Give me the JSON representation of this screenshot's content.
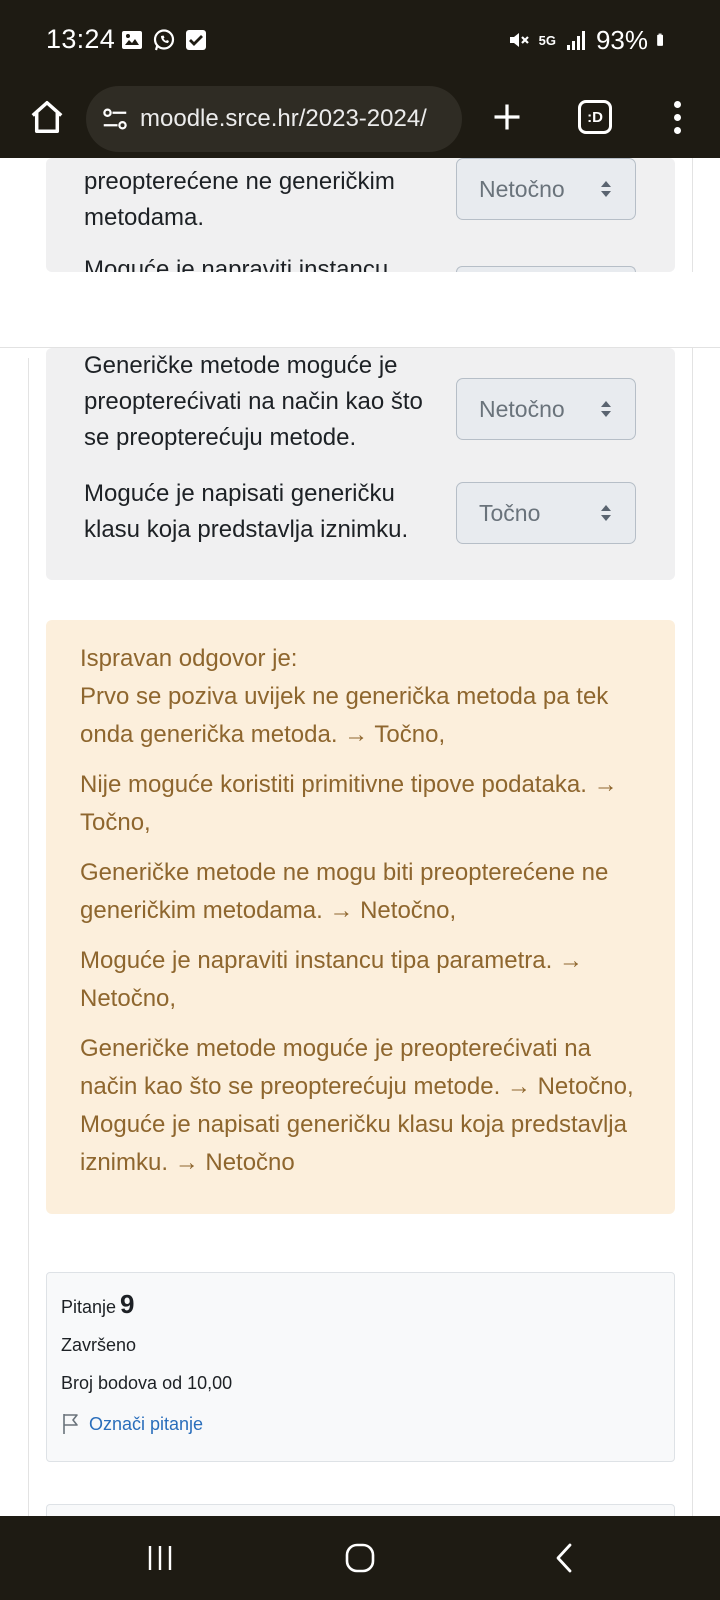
{
  "status_bar": {
    "time": "13:24",
    "network": "5G",
    "battery": "93%"
  },
  "browser": {
    "url": "moodle.srce.hr/2023-2024/",
    "tabs_label": ":D"
  },
  "question_top": {
    "partial_text": "preopterećene ne generičkim metodama.",
    "partial_select": "Netočno",
    "clipped_text": "Moguće je napraviti instancu"
  },
  "question_items": [
    {
      "text": "Generičke metode moguće je preopterećivati na način kao što se preopterećuju metode.",
      "selected": "Netočno"
    },
    {
      "text": "Moguće je napisati generičku klasu koja predstavlja iznimku.",
      "selected": "Točno"
    }
  ],
  "feedback": {
    "heading": "Ispravan odgovor je:",
    "p1": "Prvo se poziva uvijek ne generička metoda pa tek onda generička metoda. → Točno,",
    "p2": "Nije moguće koristiti primitivne tipove podataka. → Točno,",
    "p3": "Generičke metode ne mogu biti preopterećene ne generičkim metodama. → Netočno,",
    "p4": "Moguće je napraviti instancu tipa parametra. → Netočno,",
    "p5": "Generičke metode moguće je preopterećivati na način kao što se preopterećuju metode. → Netočno, Moguće je napisati generičku klasu koja predstavlja iznimku. → Netočno"
  },
  "question_info": {
    "label": "Pitanje",
    "number": "9",
    "state": "Završeno",
    "points": "Broj bodova od 10,00",
    "flag_label": "Označi pitanje"
  },
  "colors": {
    "system_bar": "#1e1b13",
    "feedback_bg": "#fcefdc",
    "feedback_text": "#8e662e",
    "question_bg": "#f0f0f1",
    "link": "#2a6ebb"
  }
}
